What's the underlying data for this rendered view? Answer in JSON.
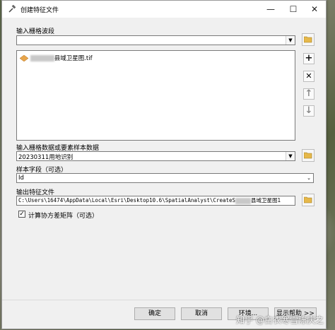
{
  "window": {
    "title": "创建特征文件",
    "minimize": "—",
    "maximize": "☐",
    "close": "✕"
  },
  "input_raster": {
    "label": "输入栅格波段",
    "value": "",
    "items": [
      "县域卫星图.tif"
    ]
  },
  "training_data": {
    "label": "输入栅格数据或要素样本数据",
    "value": "20230311用地识别"
  },
  "sample_field": {
    "label": "样本字段（可选）",
    "value": "Id"
  },
  "output": {
    "label": "输出特征文件",
    "value": "C:\\Users\\16474\\AppData\\Local\\Esri\\Desktop10.6\\SpatialAnalyst\\CreateS",
    "value_tail": "县域卫星图1"
  },
  "covariance": {
    "label": "计算协方差矩阵（可选）",
    "checked": "✓"
  },
  "buttons": {
    "ok": "确定",
    "cancel": "取消",
    "env": "环境...",
    "help": "显示帮助 >>"
  },
  "watermark": "知乎 @白衣寒雪陈庆之",
  "colors": {
    "accent": "#1e5fb4",
    "folder": "#e6b84a"
  }
}
